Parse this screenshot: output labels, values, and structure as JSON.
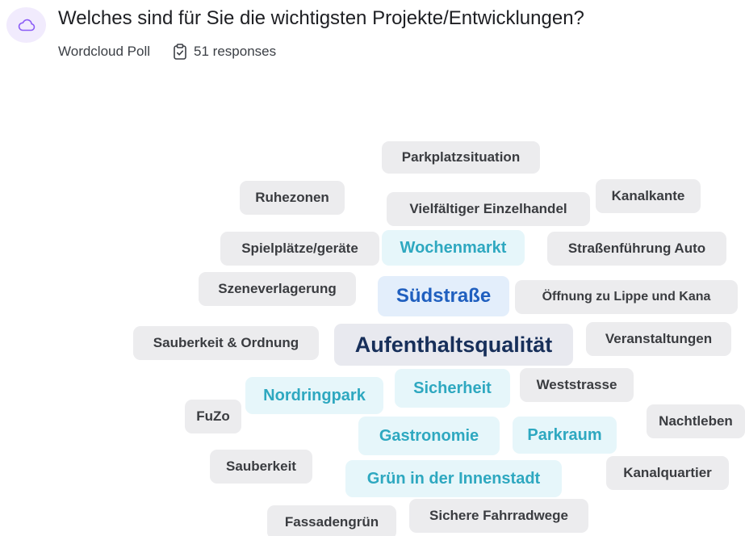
{
  "header": {
    "title": "Welches sind für Sie die wichtigsten Projekte/Entwicklungen?",
    "poll_type": "Wordcloud Poll",
    "responses": "51 responses",
    "icon": "cloud-icon",
    "response_icon": "clipboard-check-icon",
    "accent_color": "#8b5cf6"
  },
  "colors": {
    "gray_bg": "#ececee",
    "cyan_bg": "#e6f6fa",
    "cyan_text": "#2ea8c0",
    "blue_bg": "#e3eefb",
    "blue_text": "#1f5fbf",
    "navy_text": "#172f5a"
  },
  "words": [
    {
      "text": "Parkplatzsituation",
      "style": "gray"
    },
    {
      "text": "Ruhezonen",
      "style": "gray"
    },
    {
      "text": "Vielfältiger Einzelhandel",
      "style": "gray"
    },
    {
      "text": "Kanalkante",
      "style": "gray"
    },
    {
      "text": "Spielplätze/geräte",
      "style": "gray"
    },
    {
      "text": "Wochenmarkt",
      "style": "cyan"
    },
    {
      "text": "Straßenführung Auto",
      "style": "gray"
    },
    {
      "text": "Szeneverlagerung",
      "style": "gray"
    },
    {
      "text": "Südstraße",
      "style": "blue"
    },
    {
      "text": "Öffnung zu Lippe und Kana",
      "style": "gray"
    },
    {
      "text": "Sauberkeit & Ordnung",
      "style": "gray"
    },
    {
      "text": "Aufenthaltsqualität",
      "style": "navy"
    },
    {
      "text": "Veranstaltungen",
      "style": "gray"
    },
    {
      "text": "Nordringpark",
      "style": "cyan"
    },
    {
      "text": "Sicherheit",
      "style": "cyan"
    },
    {
      "text": "Weststrasse",
      "style": "gray"
    },
    {
      "text": "FuZo",
      "style": "gray"
    },
    {
      "text": "Nachtleben",
      "style": "gray"
    },
    {
      "text": "Gastronomie",
      "style": "cyan"
    },
    {
      "text": "Parkraum",
      "style": "cyan"
    },
    {
      "text": "Sauberkeit",
      "style": "gray"
    },
    {
      "text": "Grün in der Innenstadt",
      "style": "cyan"
    },
    {
      "text": "Kanalquartier",
      "style": "gray"
    },
    {
      "text": "Fassadengrün",
      "style": "gray"
    },
    {
      "text": "Sichere Fahrradwege",
      "style": "gray"
    }
  ]
}
